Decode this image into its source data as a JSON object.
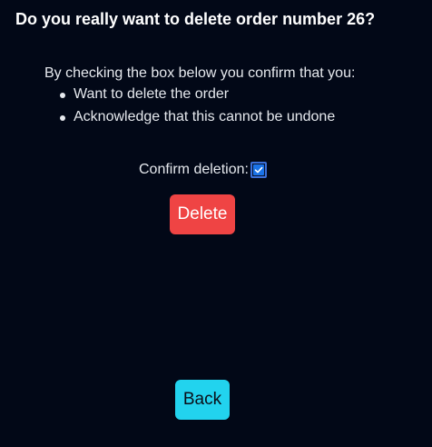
{
  "dialog": {
    "title": "Do you really want to delete order number 26?",
    "intro": "By checking the box below you confirm that you:",
    "bullets": [
      "Want to delete the order",
      "Acknowledge that this cannot be undone"
    ],
    "confirm_label": "Confirm deletion:",
    "confirm_checked": true,
    "delete_label": "Delete",
    "back_label": "Back"
  },
  "colors": {
    "background": "#020817",
    "delete_button": "#ef4444",
    "back_button": "#22d3ee",
    "checkbox": "#1a73e8"
  },
  "icons": {
    "checkbox": "check-icon"
  }
}
